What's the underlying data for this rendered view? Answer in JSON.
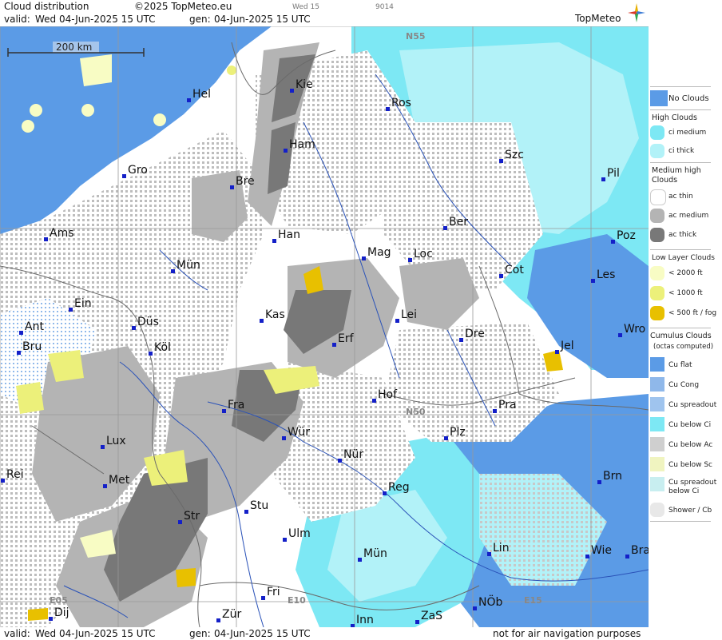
{
  "header": {
    "product": "Cloud distribution",
    "copyright": "©2025 TopMeteo.eu",
    "day": "Wed 15",
    "code": "9014",
    "valid_label": "valid:",
    "valid_date": "Wed  04-Jun-2025  15 UTC",
    "gen_label": "gen:",
    "gen_date": "04-Jun-2025 15 UTC"
  },
  "logo": {
    "text": "TopMeteo"
  },
  "footer": {
    "valid_label": "valid:",
    "valid_date": "Wed  04-Jun-2025  15 UTC",
    "gen_label": "gen:",
    "gen_date": "04-Jun-2025 15 UTC",
    "disclaimer": "not for air navigation purposes"
  },
  "map": {
    "scale_label": "200 km",
    "grid_labels": [
      "N55",
      "N50",
      "E05",
      "E10",
      "E15"
    ],
    "cities": [
      {
        "name": "Hel"
      },
      {
        "name": "Kie"
      },
      {
        "name": "Ros"
      },
      {
        "name": "Ham"
      },
      {
        "name": "Szc"
      },
      {
        "name": "Gro"
      },
      {
        "name": "Bre"
      },
      {
        "name": "Pil"
      },
      {
        "name": "Ber"
      },
      {
        "name": "Ams"
      },
      {
        "name": "Han"
      },
      {
        "name": "Poz"
      },
      {
        "name": "Mün"
      },
      {
        "name": "Mag"
      },
      {
        "name": "Loc"
      },
      {
        "name": "Cot"
      },
      {
        "name": "Les"
      },
      {
        "name": "Ein"
      },
      {
        "name": "Lei"
      },
      {
        "name": "Kas"
      },
      {
        "name": "Ant"
      },
      {
        "name": "Düs"
      },
      {
        "name": "Dre"
      },
      {
        "name": "Wro"
      },
      {
        "name": "Bru"
      },
      {
        "name": "Erf"
      },
      {
        "name": "Köl"
      },
      {
        "name": "Jel"
      },
      {
        "name": "Hof"
      },
      {
        "name": "Fra"
      },
      {
        "name": "Pra"
      },
      {
        "name": "Lux"
      },
      {
        "name": "Wür"
      },
      {
        "name": "Plz"
      },
      {
        "name": "Nür"
      },
      {
        "name": "Rei"
      },
      {
        "name": "Met"
      },
      {
        "name": "Reg"
      },
      {
        "name": "Brn"
      },
      {
        "name": "Stu"
      },
      {
        "name": "Str"
      },
      {
        "name": "Ulm"
      },
      {
        "name": "Lin"
      },
      {
        "name": "Mün"
      },
      {
        "name": "Wie"
      },
      {
        "name": "Bra"
      },
      {
        "name": "Fri"
      },
      {
        "name": "NÖb"
      },
      {
        "name": "Dij"
      },
      {
        "name": "Zür"
      },
      {
        "name": "Inn"
      },
      {
        "name": "ZaS"
      }
    ]
  },
  "legend": {
    "no_clouds": "No Clouds",
    "high_title": "High Clouds",
    "ci_medium": "ci medium",
    "ci_thick": "ci thick",
    "medium_title": "Medium high Clouds",
    "ac_thin": "ac thin",
    "ac_medium": "ac medium",
    "ac_thick": "ac thick",
    "low_title": "Low Layer Clouds",
    "low_2000": "< 2000 ft",
    "low_1000": "< 1000 ft",
    "low_500": "< 500 ft / fog",
    "cu_title": "Cumulus Clouds",
    "cu_sub": "(octas computed)",
    "cu_flat": "Cu flat",
    "cu_cong": "Cu Cong",
    "cu_spreadout": "Cu spreadout",
    "cu_below_ci": "Cu below Ci",
    "cu_below_ac": "Cu below Ac",
    "cu_below_sc": "Cu below Sc",
    "cu_spread_below_ci_1": "Cu spreadout",
    "cu_spread_below_ci_2": "below Ci",
    "shower": "Shower / Cb",
    "colors": {
      "no_clouds": "#5b9be6",
      "ci_medium": "#7de8f4",
      "ci_thick": "#b2f2f8",
      "ac_thin": "#ffffff",
      "ac_medium": "#b4b4b4",
      "ac_thick": "#787878",
      "low_2000": "#f8fcc4",
      "low_1000": "#ecf07a",
      "low_500": "#e8c000"
    }
  }
}
